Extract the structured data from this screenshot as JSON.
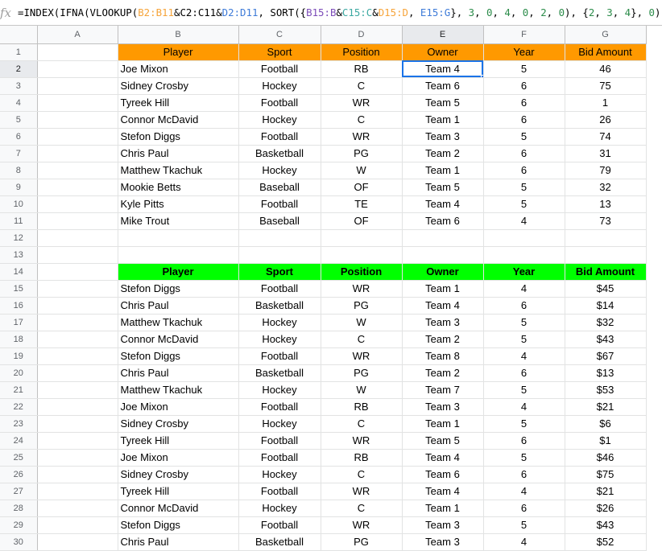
{
  "formula_bar": {
    "fx_label": "fx",
    "segments": [
      {
        "t": "=INDEX(IFNA(VLOOKUP(",
        "c": ""
      },
      {
        "t": "B2:B11",
        "c": "f-or"
      },
      {
        "t": "&C2:C11&",
        "c": ""
      },
      {
        "t": "D2:D11",
        "c": "f-bl"
      },
      {
        "t": ", SORT({",
        "c": ""
      },
      {
        "t": "B15:B",
        "c": "f-pu"
      },
      {
        "t": "&",
        "c": ""
      },
      {
        "t": "C15:C",
        "c": "f-te"
      },
      {
        "t": "&",
        "c": ""
      },
      {
        "t": "D15:D",
        "c": "f-or"
      },
      {
        "t": ", ",
        "c": ""
      },
      {
        "t": "E15:G",
        "c": "f-bl"
      },
      {
        "t": "}, ",
        "c": ""
      },
      {
        "t": "3",
        "c": "f-nm"
      },
      {
        "t": ", ",
        "c": ""
      },
      {
        "t": "0",
        "c": "f-nm"
      },
      {
        "t": ", ",
        "c": ""
      },
      {
        "t": "4",
        "c": "f-nm"
      },
      {
        "t": ", ",
        "c": ""
      },
      {
        "t": "0",
        "c": "f-nm"
      },
      {
        "t": ", ",
        "c": ""
      },
      {
        "t": "2",
        "c": "f-nm"
      },
      {
        "t": ", ",
        "c": ""
      },
      {
        "t": "0",
        "c": "f-nm"
      },
      {
        "t": "), {",
        "c": ""
      },
      {
        "t": "2",
        "c": "f-nm"
      },
      {
        "t": ", ",
        "c": ""
      },
      {
        "t": "3",
        "c": "f-nm"
      },
      {
        "t": ", ",
        "c": ""
      },
      {
        "t": "4",
        "c": "f-nm"
      },
      {
        "t": "}, ",
        "c": ""
      },
      {
        "t": "0",
        "c": "f-nm"
      },
      {
        "t": ")))",
        "c": ""
      }
    ]
  },
  "columns": [
    "A",
    "B",
    "C",
    "D",
    "E",
    "F",
    "G"
  ],
  "selected_column": "E",
  "selected_row": 2,
  "active_cell": "E2",
  "colors": {
    "top_header": "#ff9900",
    "bottom_header": "#00ff00",
    "selection": "#1a73e8"
  },
  "rows": [
    {
      "n": "1",
      "style": "orange",
      "cells": [
        "Player",
        "Sport",
        "Position",
        "Owner",
        "Year",
        "Bid Amount"
      ]
    },
    {
      "n": "2",
      "cells": [
        "Joe Mixon",
        "Football",
        "RB",
        "Team 4",
        "5",
        "46"
      ]
    },
    {
      "n": "3",
      "cells": [
        "Sidney Crosby",
        "Hockey",
        "C",
        "Team 6",
        "6",
        "75"
      ]
    },
    {
      "n": "4",
      "cells": [
        "Tyreek Hill",
        "Football",
        "WR",
        "Team 5",
        "6",
        "1"
      ]
    },
    {
      "n": "5",
      "cells": [
        "Connor McDavid",
        "Hockey",
        "C",
        "Team 1",
        "6",
        "26"
      ]
    },
    {
      "n": "6",
      "cells": [
        "Stefon Diggs",
        "Football",
        "WR",
        "Team 3",
        "5",
        "74"
      ]
    },
    {
      "n": "7",
      "cells": [
        "Chris Paul",
        "Basketball",
        "PG",
        "Team 2",
        "6",
        "31"
      ]
    },
    {
      "n": "8",
      "cells": [
        "Matthew Tkachuk",
        "Hockey",
        "W",
        "Team 1",
        "6",
        "79"
      ]
    },
    {
      "n": "9",
      "cells": [
        "Mookie Betts",
        "Baseball",
        "OF",
        "Team 5",
        "5",
        "32"
      ]
    },
    {
      "n": "10",
      "cells": [
        "Kyle Pitts",
        "Football",
        "TE",
        "Team 4",
        "5",
        "13"
      ]
    },
    {
      "n": "11",
      "cells": [
        "Mike Trout",
        "Baseball",
        "OF",
        "Team 6",
        "4",
        "73"
      ]
    },
    {
      "n": "12",
      "cells": [
        "",
        "",
        "",
        "",
        "",
        ""
      ]
    },
    {
      "n": "13",
      "cells": [
        "",
        "",
        "",
        "",
        "",
        ""
      ]
    },
    {
      "n": "14",
      "style": "green",
      "cells": [
        "Player",
        "Sport",
        "Position",
        "Owner",
        "Year",
        "Bid Amount"
      ]
    },
    {
      "n": "15",
      "cells": [
        "Stefon Diggs",
        "Football",
        "WR",
        "Team 1",
        "4",
        "$45"
      ]
    },
    {
      "n": "16",
      "cells": [
        "Chris Paul",
        "Basketball",
        "PG",
        "Team 4",
        "6",
        "$14"
      ]
    },
    {
      "n": "17",
      "cells": [
        "Matthew Tkachuk",
        "Hockey",
        "W",
        "Team 3",
        "5",
        "$32"
      ]
    },
    {
      "n": "18",
      "cells": [
        "Connor McDavid",
        "Hockey",
        "C",
        "Team 2",
        "5",
        "$43"
      ]
    },
    {
      "n": "19",
      "cells": [
        "Stefon Diggs",
        "Football",
        "WR",
        "Team 8",
        "4",
        "$67"
      ]
    },
    {
      "n": "20",
      "cells": [
        "Chris Paul",
        "Basketball",
        "PG",
        "Team 2",
        "6",
        "$13"
      ]
    },
    {
      "n": "21",
      "cells": [
        "Matthew Tkachuk",
        "Hockey",
        "W",
        "Team 7",
        "5",
        "$53"
      ]
    },
    {
      "n": "22",
      "cells": [
        "Joe Mixon",
        "Football",
        "RB",
        "Team 3",
        "4",
        "$21"
      ]
    },
    {
      "n": "23",
      "cells": [
        "Sidney Crosby",
        "Hockey",
        "C",
        "Team 1",
        "5",
        "$6"
      ]
    },
    {
      "n": "24",
      "cells": [
        "Tyreek Hill",
        "Football",
        "WR",
        "Team 5",
        "6",
        "$1"
      ]
    },
    {
      "n": "25",
      "cells": [
        "Joe Mixon",
        "Football",
        "RB",
        "Team 4",
        "5",
        "$46"
      ]
    },
    {
      "n": "26",
      "cells": [
        "Sidney Crosby",
        "Hockey",
        "C",
        "Team 6",
        "6",
        "$75"
      ]
    },
    {
      "n": "27",
      "cells": [
        "Tyreek Hill",
        "Football",
        "WR",
        "Team 4",
        "4",
        "$21"
      ]
    },
    {
      "n": "28",
      "cells": [
        "Connor McDavid",
        "Hockey",
        "C",
        "Team 1",
        "6",
        "$26"
      ]
    },
    {
      "n": "29",
      "cells": [
        "Stefon Diggs",
        "Football",
        "WR",
        "Team 3",
        "5",
        "$43"
      ]
    },
    {
      "n": "30",
      "cells": [
        "Chris Paul",
        "Basketball",
        "PG",
        "Team 3",
        "4",
        "$52"
      ]
    }
  ]
}
